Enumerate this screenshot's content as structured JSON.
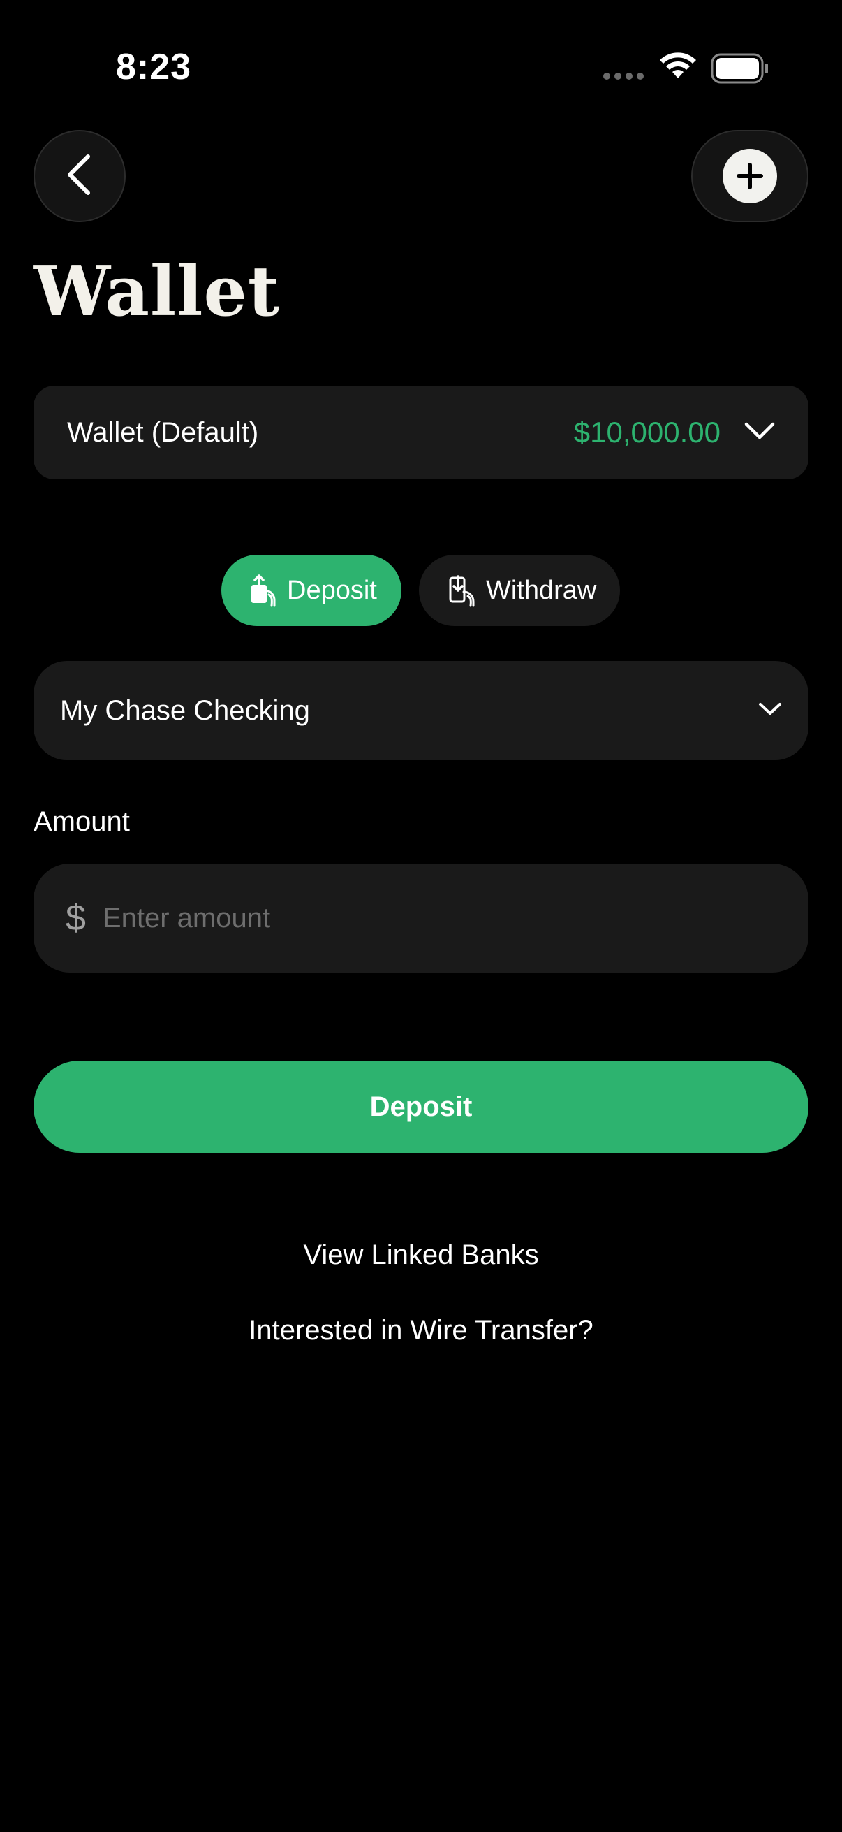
{
  "status_bar": {
    "time": "8:23"
  },
  "header": {
    "title": "Wallet"
  },
  "wallet_selector": {
    "name": "Wallet (Default)",
    "balance": "$10,000.00",
    "balance_color": "#2db36f"
  },
  "tabs": [
    {
      "label": "Deposit",
      "icon": "deposit-icon",
      "active": true
    },
    {
      "label": "Withdraw",
      "icon": "withdraw-icon",
      "active": false
    }
  ],
  "bank_select": {
    "selected": "My Chase Checking"
  },
  "amount": {
    "label": "Amount",
    "currency_symbol": "$",
    "placeholder": "Enter amount",
    "value": ""
  },
  "primary_action": {
    "label": "Deposit"
  },
  "links": {
    "linked_banks": "View Linked Banks",
    "wire_transfer": "Interested in Wire Transfer?"
  },
  "colors": {
    "accent": "#2db36f",
    "background": "#000000",
    "surface": "#1a1a1a"
  }
}
